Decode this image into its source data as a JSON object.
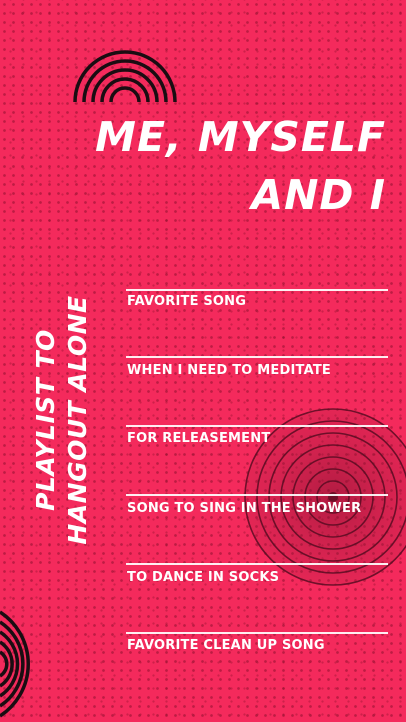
{
  "title": {
    "line1": "ME, MYSELF",
    "line2": "AND I"
  },
  "side_title": {
    "line1": "PLAYLIST TO",
    "line2": "HANGOUT ALONE"
  },
  "songs": [
    "FAVORITE SONG",
    "WHEN I NEED TO MEDITATE",
    "FOR RELEASEMENT",
    "SONG TO SING IN THE SHOWER",
    "TO DANCE IN SOCKS",
    "FAVORITE CLEAN UP SONG"
  ],
  "colors": {
    "background": "#f42a5c",
    "text": "#ffffff",
    "decoration": "#1a0d12"
  }
}
